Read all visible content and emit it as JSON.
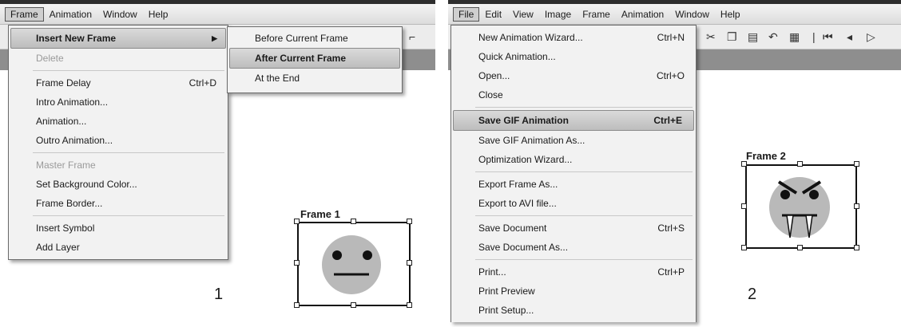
{
  "panel1": {
    "menubar": [
      "Frame",
      "Animation",
      "Window",
      "Help"
    ],
    "frame_menu": [
      {
        "label": "Insert New Frame",
        "shortcut": "",
        "state": "highlighted-submenu"
      },
      {
        "label": "Delete",
        "shortcut": "",
        "state": "disabled"
      },
      {
        "sep": true
      },
      {
        "label": "Frame Delay",
        "shortcut": "Ctrl+D",
        "state": "normal"
      },
      {
        "label": "Intro Animation...",
        "shortcut": "",
        "state": "normal"
      },
      {
        "label": "Animation...",
        "shortcut": "",
        "state": "normal"
      },
      {
        "label": "Outro Animation...",
        "shortcut": "",
        "state": "normal"
      },
      {
        "sep": true
      },
      {
        "label": "Master Frame",
        "shortcut": "",
        "state": "disabled"
      },
      {
        "label": "Set Background Color...",
        "shortcut": "",
        "state": "normal"
      },
      {
        "label": "Frame Border...",
        "shortcut": "",
        "state": "normal"
      },
      {
        "sep": true
      },
      {
        "label": "Insert Symbol",
        "shortcut": "",
        "state": "normal"
      },
      {
        "label": "Add Layer",
        "shortcut": "",
        "state": "normal"
      }
    ],
    "submenu": [
      {
        "label": "Before Current Frame",
        "state": "normal"
      },
      {
        "label": "After Current Frame",
        "state": "highlighted"
      },
      {
        "label": "At the End",
        "state": "normal"
      }
    ],
    "frame_label": "Frame 1",
    "step_number": "1"
  },
  "panel2": {
    "menubar": [
      "File",
      "Edit",
      "View",
      "Image",
      "Frame",
      "Animation",
      "Window",
      "Help"
    ],
    "file_menu": [
      {
        "label": "New Animation Wizard...",
        "shortcut": "Ctrl+N",
        "state": "normal"
      },
      {
        "label": "Quick Animation...",
        "shortcut": "",
        "state": "normal"
      },
      {
        "label": "Open...",
        "shortcut": "Ctrl+O",
        "state": "normal"
      },
      {
        "label": "Close",
        "shortcut": "",
        "state": "normal"
      },
      {
        "sep": true
      },
      {
        "label": "Save GIF Animation",
        "shortcut": "Ctrl+E",
        "state": "highlighted"
      },
      {
        "label": "Save GIF Animation As...",
        "shortcut": "",
        "state": "normal"
      },
      {
        "label": "Optimization Wizard...",
        "shortcut": "",
        "state": "normal"
      },
      {
        "sep": true
      },
      {
        "label": "Export Frame As...",
        "shortcut": "",
        "state": "normal"
      },
      {
        "label": "Export to AVI file...",
        "shortcut": "",
        "state": "normal"
      },
      {
        "sep": true
      },
      {
        "label": "Save Document",
        "shortcut": "Ctrl+S",
        "state": "normal"
      },
      {
        "label": "Save Document As...",
        "shortcut": "",
        "state": "normal"
      },
      {
        "sep": true
      },
      {
        "label": "Print...",
        "shortcut": "Ctrl+P",
        "state": "normal"
      },
      {
        "label": "Print Preview",
        "shortcut": "",
        "state": "normal"
      },
      {
        "label": "Print Setup...",
        "shortcut": "",
        "state": "normal"
      }
    ],
    "toolbar_icons": [
      "cut-icon",
      "copy-icon",
      "paste-icon",
      "undo-icon",
      "frames-icon",
      "first-frame-icon",
      "previous-frame-icon",
      "play-icon"
    ],
    "frame_label": "Frame 2",
    "step_number": "2"
  }
}
